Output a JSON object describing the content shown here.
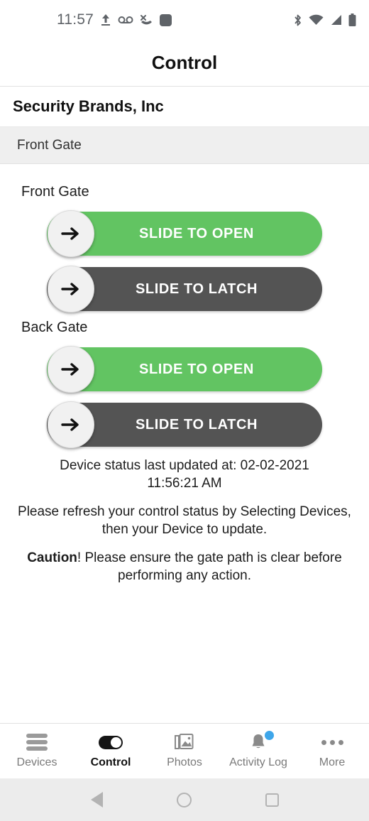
{
  "status_bar": {
    "time": "11:57",
    "left_icons": [
      "upload-icon",
      "voicemail-icon",
      "missed-call-icon",
      "app-square-icon"
    ],
    "right_icons": [
      "bluetooth-icon",
      "wifi-icon",
      "cellular-signal-icon",
      "battery-icon"
    ]
  },
  "header": {
    "title": "Control"
  },
  "company": {
    "name": "Security Brands, Inc"
  },
  "section_band": {
    "label": "Front Gate"
  },
  "colors": {
    "open_green": "#62c462",
    "latch_gray": "#545454",
    "badge_blue": "#3ea6ea",
    "band_gray": "#efefef",
    "nav_gray": "#ececec"
  },
  "gates": [
    {
      "name": "Front Gate",
      "controls": [
        {
          "label": "SLIDE TO OPEN",
          "style": "green",
          "knob_icon": "arrow-right-icon"
        },
        {
          "label": "SLIDE TO LATCH",
          "style": "dark",
          "knob_icon": "arrow-right-icon"
        }
      ]
    },
    {
      "name": "Back Gate",
      "controls": [
        {
          "label": "SLIDE TO OPEN",
          "style": "green",
          "knob_icon": "arrow-right-icon"
        },
        {
          "label": "SLIDE TO LATCH",
          "style": "dark",
          "knob_icon": "arrow-right-icon"
        }
      ]
    }
  ],
  "info": {
    "status_line_1": "Device status last updated at: 02-02-2021",
    "status_line_2": "11:56:21 AM",
    "refresh_note": "Please refresh your control status by Selecting Devices, then your Device to update.",
    "caution_word": "Caution",
    "caution_rest": "! Please ensure the gate path is clear before performing any action."
  },
  "tab_bar": {
    "items": [
      {
        "label": "Devices",
        "icon": "stacked-bars-icon",
        "active": false,
        "badge": false
      },
      {
        "label": "Control",
        "icon": "toggle-switch-icon",
        "active": true,
        "badge": false
      },
      {
        "label": "Photos",
        "icon": "photos-icon",
        "active": false,
        "badge": false
      },
      {
        "label": "Activity Log",
        "icon": "bell-icon",
        "active": false,
        "badge": true
      },
      {
        "label": "More",
        "icon": "ellipsis-icon",
        "active": false,
        "badge": false
      }
    ]
  },
  "android_nav": {
    "back": "back-triangle-icon",
    "home": "home-circle-icon",
    "recents": "recents-square-icon"
  }
}
